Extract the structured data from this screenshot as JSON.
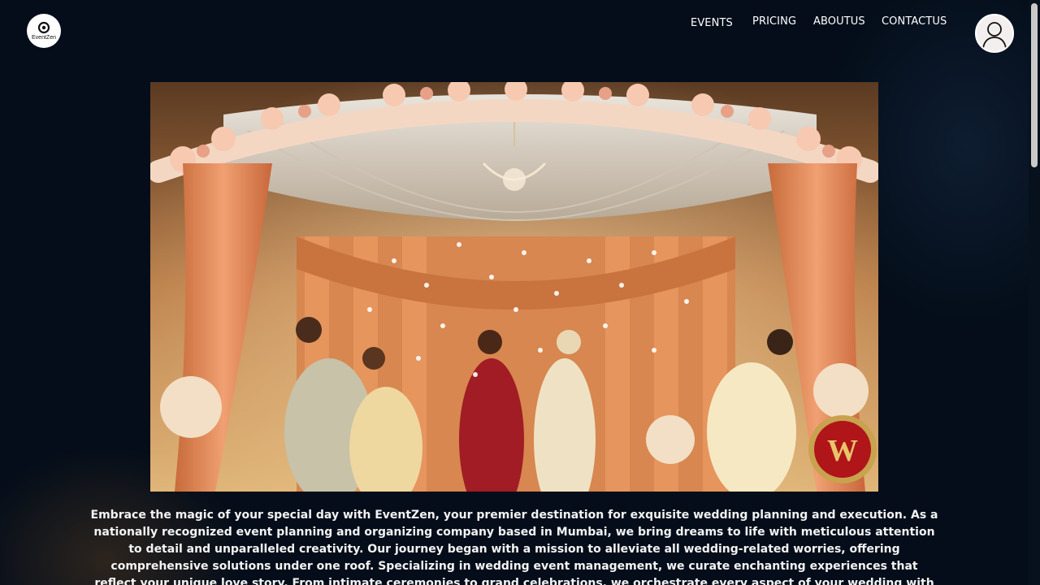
{
  "header": {
    "logo_text": "EventZen",
    "nav": [
      {
        "label": "EVENTS",
        "active": true
      },
      {
        "label": "PRICING",
        "active": false
      },
      {
        "label": "ABOUTUS",
        "active": false
      },
      {
        "label": "CONTACTUS",
        "active": false
      }
    ],
    "avatar_icon": "user-profile-icon"
  },
  "hero": {
    "image_subject": "wedding mandap with bride and groom under falling petals",
    "badge_letter": "W"
  },
  "intro": {
    "text": "Embrace the magic of your special day with EventZen, your premier destination for exquisite wedding planning and execution. As a nationally recognized event planning and organizing company based in Mumbai, we bring dreams to life with meticulous attention to detail and unparalleled creativity. Our journey began with a mission to alleviate all wedding-related worries, offering comprehensive solutions under one roof. Specializing in wedding event management, we curate enchanting experiences that reflect your unique love story. From intimate ceremonies to grand celebrations, we orchestrate every aspect of your wedding with finesse and elegance. With a reputation"
  },
  "colors": {
    "background": "#040d19",
    "text": "#f3f3f3",
    "accent_gold": "#d8a24a",
    "badge_red": "#b0151a"
  }
}
